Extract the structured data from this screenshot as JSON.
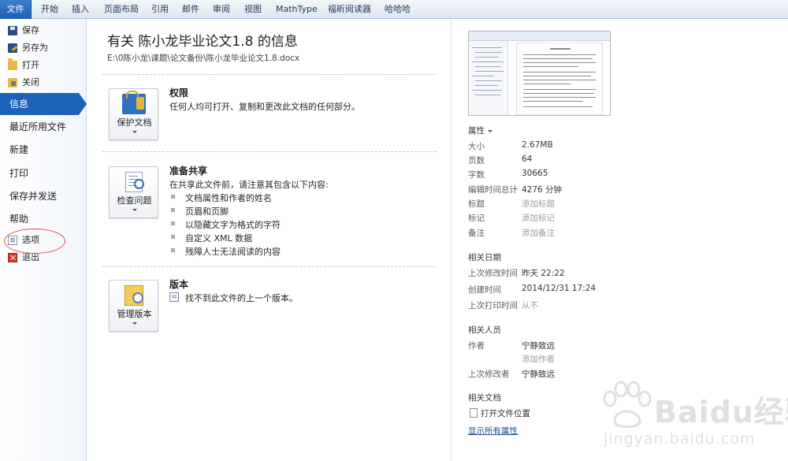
{
  "ribbon": {
    "tabs": [
      "文件",
      "开始",
      "插入",
      "页面布局",
      "引用",
      "邮件",
      "审阅",
      "视图",
      "MathType",
      "福昕阅读器",
      "哈哈哈"
    ]
  },
  "nav": {
    "save": "保存",
    "save_as": "另存为",
    "open": "打开",
    "close": "关闭",
    "info": "信息",
    "recent": "最近所用文件",
    "new": "新建",
    "print": "打印",
    "save_send": "保存并发送",
    "help": "帮助",
    "options": "选项",
    "exit": "退出"
  },
  "info": {
    "title": "有关 陈小龙毕业论文1.8 的信息",
    "path": "E:\\0陈小龙\\课题\\论文备份\\陈小龙毕业论文1.8.docx"
  },
  "permissions": {
    "button": "保护文档",
    "title": "权限",
    "text": "任何人均可打开、复制和更改此文档的任何部分。"
  },
  "share": {
    "button": "检查问题",
    "title": "准备共享",
    "text": "在共享此文件前，请注意其包含以下内容:",
    "items": [
      "文档属性和作者的姓名",
      "页眉和页脚",
      "以隐藏文字为格式的字符",
      "自定义 XML 数据",
      "残障人士无法阅读的内容"
    ]
  },
  "versions": {
    "button": "管理版本",
    "title": "版本",
    "text": "找不到此文件的上一个版本。"
  },
  "properties": {
    "header": "属性",
    "rows": [
      {
        "label": "大小",
        "value": "2.67MB"
      },
      {
        "label": "页数",
        "value": "64"
      },
      {
        "label": "字数",
        "value": "30665"
      },
      {
        "label": "编辑时间总计",
        "value": "4276 分钟"
      },
      {
        "label": "标题",
        "value": "添加标题"
      },
      {
        "label": "标记",
        "value": "添加标记"
      },
      {
        "label": "备注",
        "value": "添加备注"
      }
    ],
    "dates_header": "相关日期",
    "dates": [
      {
        "label": "上次修改时间",
        "value": "昨天 22:22"
      },
      {
        "label": "创建时间",
        "value": "2014/12/31 17:24"
      },
      {
        "label": "上次打印时间",
        "value": "从不"
      }
    ],
    "people_header": "相关人员",
    "author_label": "作者",
    "author_value": "宁静致远",
    "add_author": "添加作者",
    "modifier_label": "上次修改者",
    "modifier_value": "宁静致远",
    "docs_header": "相关文档",
    "open_location": "打开文件位置",
    "show_all": "显示所有属性"
  },
  "watermark": {
    "logo_text": "Baidu经验",
    "url": "jingyan.baidu.com"
  },
  "colors": {
    "accent": "#1e62b8",
    "annotation": "#d9534f"
  }
}
